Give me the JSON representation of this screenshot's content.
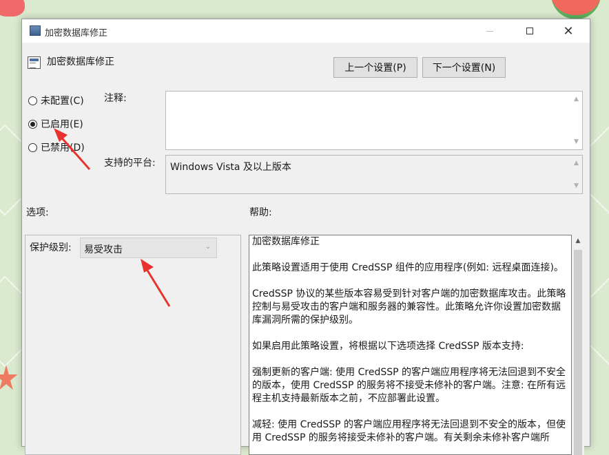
{
  "window": {
    "title": "加密数据库修正"
  },
  "header": {
    "title": "加密数据库修正",
    "prev_button": "上一个设置(P)",
    "next_button": "下一个设置(N)"
  },
  "state": {
    "options": [
      {
        "label": "未配置(C)",
        "checked": false
      },
      {
        "label": "已启用(E)",
        "checked": true
      },
      {
        "label": "已禁用(D)",
        "checked": false
      }
    ]
  },
  "fields": {
    "comment_label": "注释:",
    "comment_value": "",
    "platform_label": "支持的平台:",
    "platform_value": "Windows Vista 及以上版本"
  },
  "options_section": {
    "label": "选项:",
    "protection_label": "保护级别:",
    "protection_value": "易受攻击"
  },
  "help_section": {
    "label": "帮助:",
    "paragraphs": [
      "加密数据库修正",
      "此策略设置适用于使用 CredSSP 组件的应用程序(例如: 远程桌面连接)。",
      "CredSSP 协议的某些版本容易受到针对客户端的加密数据库攻击。此策略控制与易受攻击的客户端和服务器的兼容性。此策略允许你设置加密数据库漏洞所需的保护级别。",
      "如果启用此策略设置，将根据以下选项选择 CredSSP 版本支持:",
      "强制更新的客户端: 使用 CredSSP 的客户端应用程序将无法回退到不安全的版本，使用 CredSSP 的服务将不接受未修补的客户端。注意: 在所有远程主机支持最新版本之前，不应部署此设置。",
      "减轻: 使用 CredSSP 的客户端应用程序将无法回退到不安全的版本，但使用 CredSSP 的服务将接受未修补的客户端。有关剩余未修补客户端所"
    ]
  },
  "colors": {
    "background": "#dbe9cf",
    "annotation_arrow": "#e8322d"
  }
}
